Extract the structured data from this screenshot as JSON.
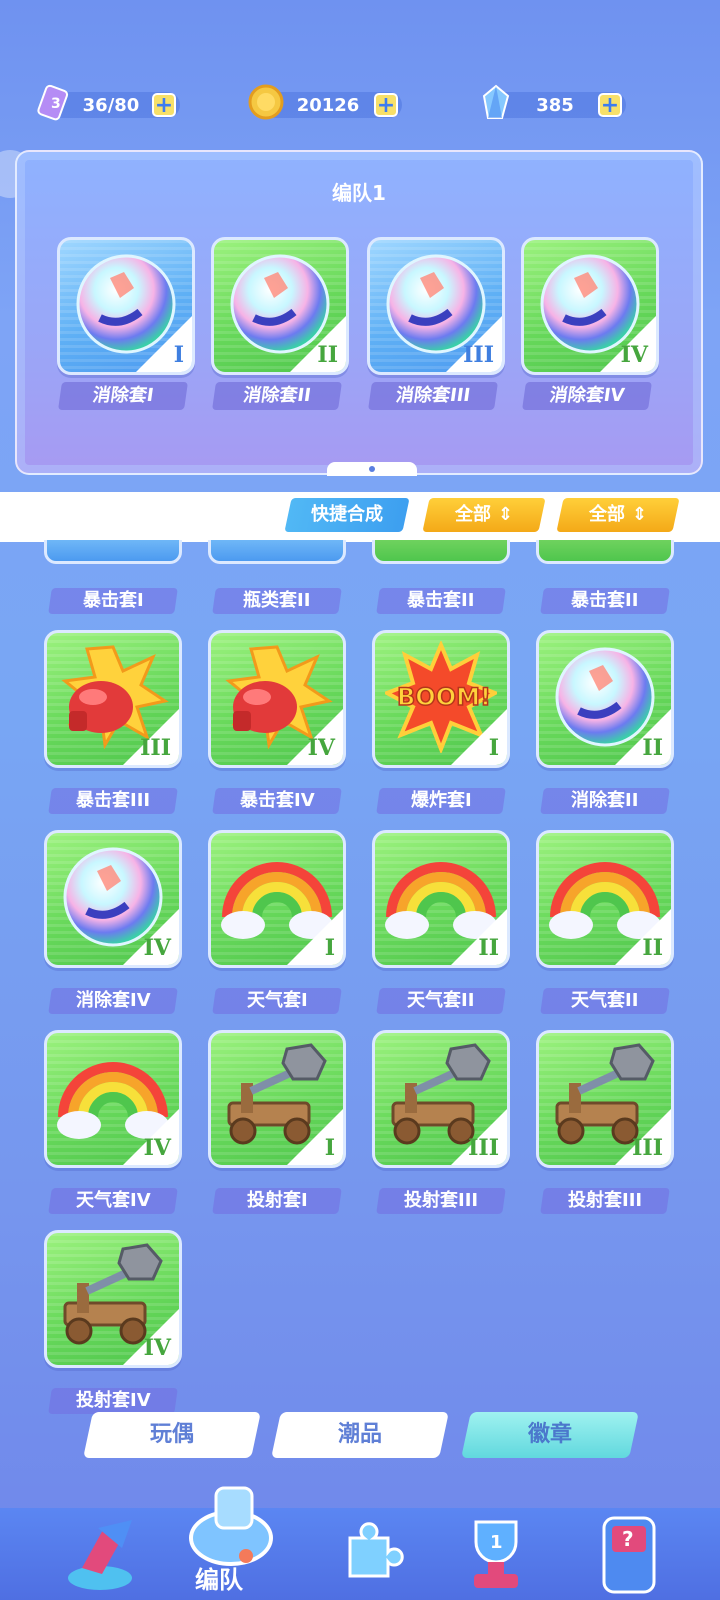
{
  "resources": [
    {
      "name": "ticket",
      "value": "36/80"
    },
    {
      "name": "coin",
      "value": "20126"
    },
    {
      "name": "crystal",
      "value": "385"
    }
  ],
  "formation": {
    "title": "编队1",
    "slots": [
      {
        "label": "消除套I",
        "level": "I",
        "color": "blue",
        "icon": "bubble-orb-icon"
      },
      {
        "label": "消除套II",
        "level": "II",
        "color": "green",
        "icon": "bubble-orb-icon"
      },
      {
        "label": "消除套III",
        "level": "III",
        "color": "blue",
        "icon": "bubble-orb-icon"
      },
      {
        "label": "消除套IV",
        "level": "IV",
        "color": "green",
        "icon": "bubble-orb-icon"
      }
    ]
  },
  "filters": {
    "quick_merge": "快捷合成",
    "filter1": "全部",
    "filter2": "全部"
  },
  "partial_row": [
    {
      "label": "暴击套I",
      "level": "I",
      "color": "blue"
    },
    {
      "label": "瓶类套II",
      "level": "II",
      "color": "blue"
    },
    {
      "label": "暴击套II",
      "level": "II",
      "color": "green"
    },
    {
      "label": "暴击套II",
      "level": "II",
      "color": "green"
    }
  ],
  "grid": [
    {
      "label": "暴击套III",
      "level": "III",
      "icon": "boxing-glove-icon"
    },
    {
      "label": "暴击套IV",
      "level": "IV",
      "icon": "boxing-glove-icon"
    },
    {
      "label": "爆炸套I",
      "level": "I",
      "icon": "boom-icon"
    },
    {
      "label": "消除套II",
      "level": "II",
      "icon": "bubble-orb-icon"
    },
    {
      "label": "消除套IV",
      "level": "IV",
      "icon": "bubble-orb-icon"
    },
    {
      "label": "天气套I",
      "level": "I",
      "icon": "rainbow-icon"
    },
    {
      "label": "天气套II",
      "level": "II",
      "icon": "rainbow-icon"
    },
    {
      "label": "天气套II",
      "level": "II",
      "icon": "rainbow-icon"
    },
    {
      "label": "天气套IV",
      "level": "IV",
      "icon": "rainbow-icon"
    },
    {
      "label": "投射套I",
      "level": "I",
      "icon": "catapult-icon"
    },
    {
      "label": "投射套III",
      "level": "III",
      "icon": "catapult-icon"
    },
    {
      "label": "投射套III",
      "level": "III",
      "icon": "catapult-icon"
    },
    {
      "label": "投射套IV",
      "level": "IV",
      "icon": "catapult-icon"
    }
  ],
  "boom_text": "BOOM!",
  "tabs": [
    "玩偶",
    "潮品",
    "徽章"
  ],
  "active_tab": "徽章",
  "bottom_nav": {
    "active_label": "编队",
    "items": [
      "battle-icon",
      "whistle-icon",
      "puzzle-icon",
      "trophy-icon",
      "mystery-machine-icon"
    ]
  }
}
